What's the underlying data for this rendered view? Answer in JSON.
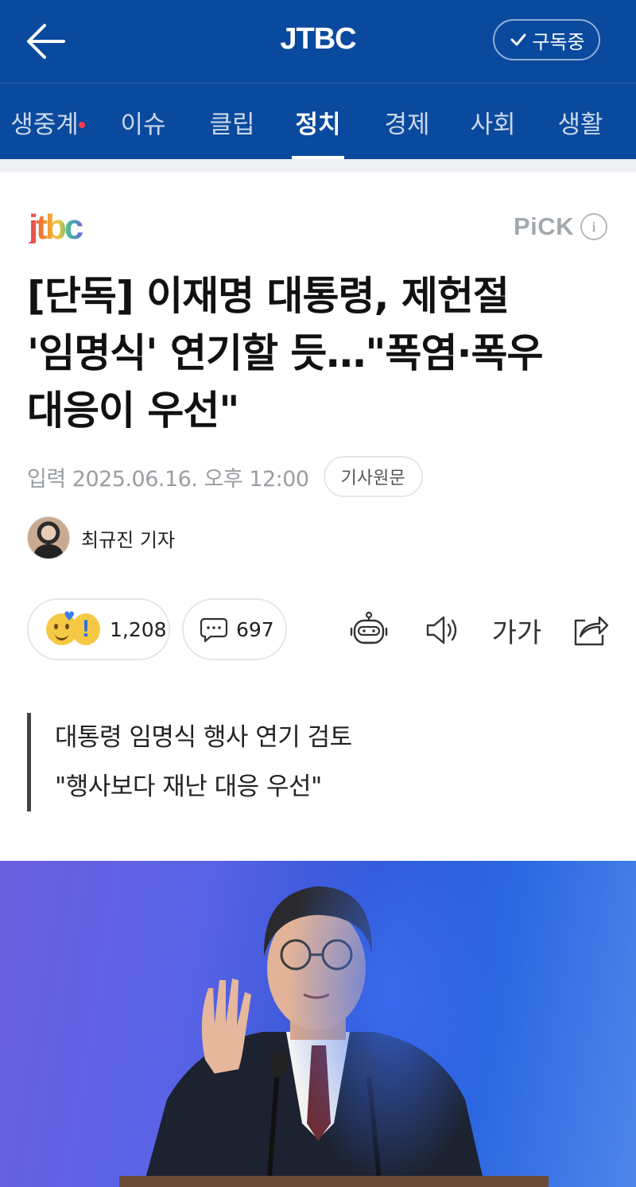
{
  "header": {
    "title": "JTBC",
    "subscribe_label": "구독중"
  },
  "tabs": [
    {
      "label": "생중계",
      "live": true
    },
    {
      "label": "이슈"
    },
    {
      "label": "클립"
    },
    {
      "label": "정치",
      "active": true
    },
    {
      "label": "경제"
    },
    {
      "label": "사회"
    },
    {
      "label": "생활"
    }
  ],
  "article": {
    "press_logo": "jtbc",
    "pick_label": "PiCK",
    "headline": "[단독] 이재명 대통령, 제헌절 '임명식' 연기할 듯…\"폭염·폭우 대응이 우선\"",
    "date": "입력 2025.06.16. 오후 12:00",
    "original_button": "기사원문",
    "reporter": "최규진 기자",
    "reaction_count": "1,208",
    "comment_count": "697",
    "font_button": "가가",
    "summary": [
      "대통령 임명식 행사 연기 검토",
      "\"행사보다 재난 대응 우선\""
    ]
  },
  "colors": {
    "header_bg": "#0a4a9e",
    "accent_red": "#ff3b4a"
  },
  "icons": [
    "back-arrow-icon",
    "check-icon",
    "info-icon",
    "comment-icon",
    "robot-icon",
    "speaker-icon",
    "share-icon"
  ]
}
